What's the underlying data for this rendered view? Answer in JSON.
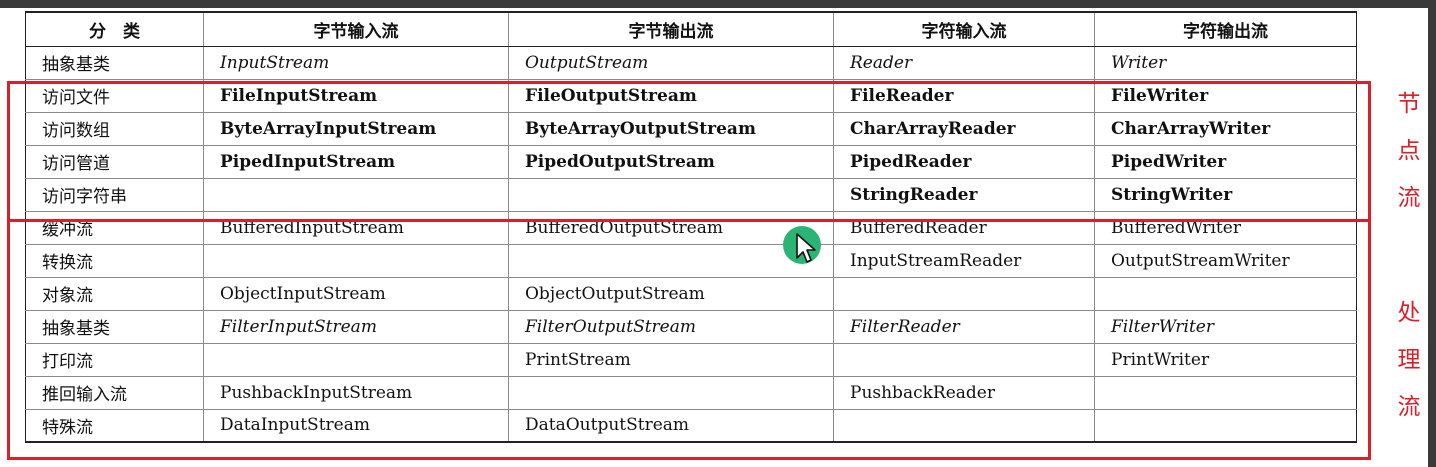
{
  "table": {
    "headers": [
      "分　类",
      "字节输入流",
      "字节输出流",
      "字符输入流",
      "字符输出流"
    ],
    "rows": [
      {
        "category": "抽象基类",
        "cells": [
          "InputStream",
          "OutputStream",
          "Reader",
          "Writer"
        ],
        "style": "italic"
      },
      {
        "category": "访问文件",
        "cells": [
          "FileInputStream",
          "FileOutputStream",
          "FileReader",
          "FileWriter"
        ],
        "style": "bold"
      },
      {
        "category": "访问数组",
        "cells": [
          "ByteArrayInputStream",
          "ByteArrayOutputStream",
          "CharArrayReader",
          "CharArrayWriter"
        ],
        "style": "bold"
      },
      {
        "category": "访问管道",
        "cells": [
          "PipedInputStream",
          "PipedOutputStream",
          "PipedReader",
          "PipedWriter"
        ],
        "style": "bold"
      },
      {
        "category": "访问字符串",
        "cells": [
          "",
          "",
          "StringReader",
          "StringWriter"
        ],
        "style": "bold"
      },
      {
        "category": "缓冲流",
        "cells": [
          "BufferedInputStream",
          "BufferedOutputStream",
          "BufferedReader",
          "BufferedWriter"
        ],
        "style": "normal"
      },
      {
        "category": "转换流",
        "cells": [
          "",
          "",
          "InputStreamReader",
          "OutputStreamWriter"
        ],
        "style": "normal"
      },
      {
        "category": "对象流",
        "cells": [
          "ObjectInputStream",
          "ObjectOutputStream",
          "",
          ""
        ],
        "style": "normal"
      },
      {
        "category": "抽象基类",
        "cells": [
          "FilterInputStream",
          "FilterOutputStream",
          "FilterReader",
          "FilterWriter"
        ],
        "style": "italic"
      },
      {
        "category": "打印流",
        "cells": [
          "",
          "PrintStream",
          "",
          "PrintWriter"
        ],
        "style": "normal"
      },
      {
        "category": "推回输入流",
        "cells": [
          "PushbackInputStream",
          "",
          "PushbackReader",
          ""
        ],
        "style": "normal"
      },
      {
        "category": "特殊流",
        "cells": [
          "DataInputStream",
          "DataOutputStream",
          "",
          ""
        ],
        "style": "normal"
      }
    ]
  },
  "annotations": {
    "node_label": [
      "节",
      "点",
      "流"
    ],
    "process_label": [
      "处",
      "理",
      "流"
    ],
    "color": "#d8202a"
  }
}
